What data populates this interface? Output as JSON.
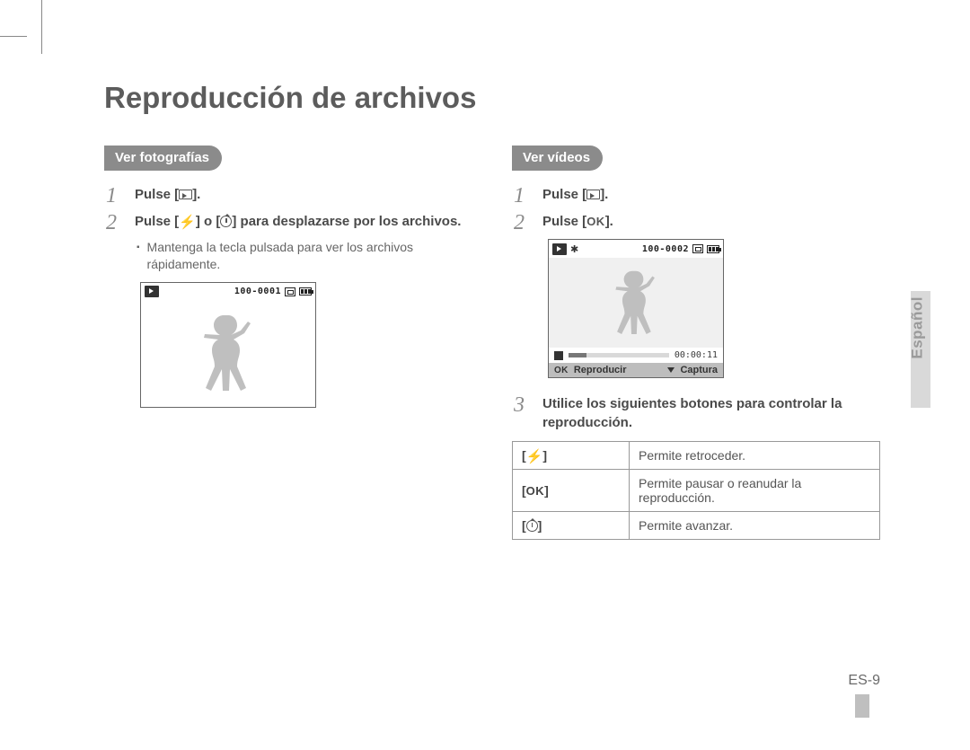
{
  "title": "Reproducción de archivos",
  "language_tab": "Español",
  "page_number": "ES-9",
  "photos": {
    "heading": "Ver fotografías",
    "steps": [
      {
        "pre": "Pulse [",
        "post": "].",
        "icon": "play-rect"
      },
      {
        "pre": "Pulse [",
        "mid": "] o [",
        "post": "] para desplazarse por los archivos.",
        "iconA": "flash",
        "iconB": "timer"
      }
    ],
    "note": "Mantenga la tecla pulsada para ver los archivos rápidamente.",
    "frame": {
      "file_index": "100-0001"
    }
  },
  "videos": {
    "heading": "Ver vídeos",
    "steps": [
      {
        "pre": "Pulse [",
        "post": "].",
        "icon": "play-rect"
      },
      {
        "pre": "Pulse [",
        "post": "].",
        "label": "OK"
      }
    ],
    "step3": "Utilice los siguientes botones para controlar la reproducción.",
    "frame": {
      "file_index": "100-0002",
      "elapsed": "00:00:11",
      "action_ok": "Reproducir",
      "action_down": "Captura"
    },
    "controls": [
      {
        "icon": "flash",
        "desc": "Permite retroceder."
      },
      {
        "label": "OK",
        "desc": "Permite pausar o reanudar la reproducción."
      },
      {
        "icon": "timer",
        "desc": "Permite avanzar."
      }
    ]
  }
}
